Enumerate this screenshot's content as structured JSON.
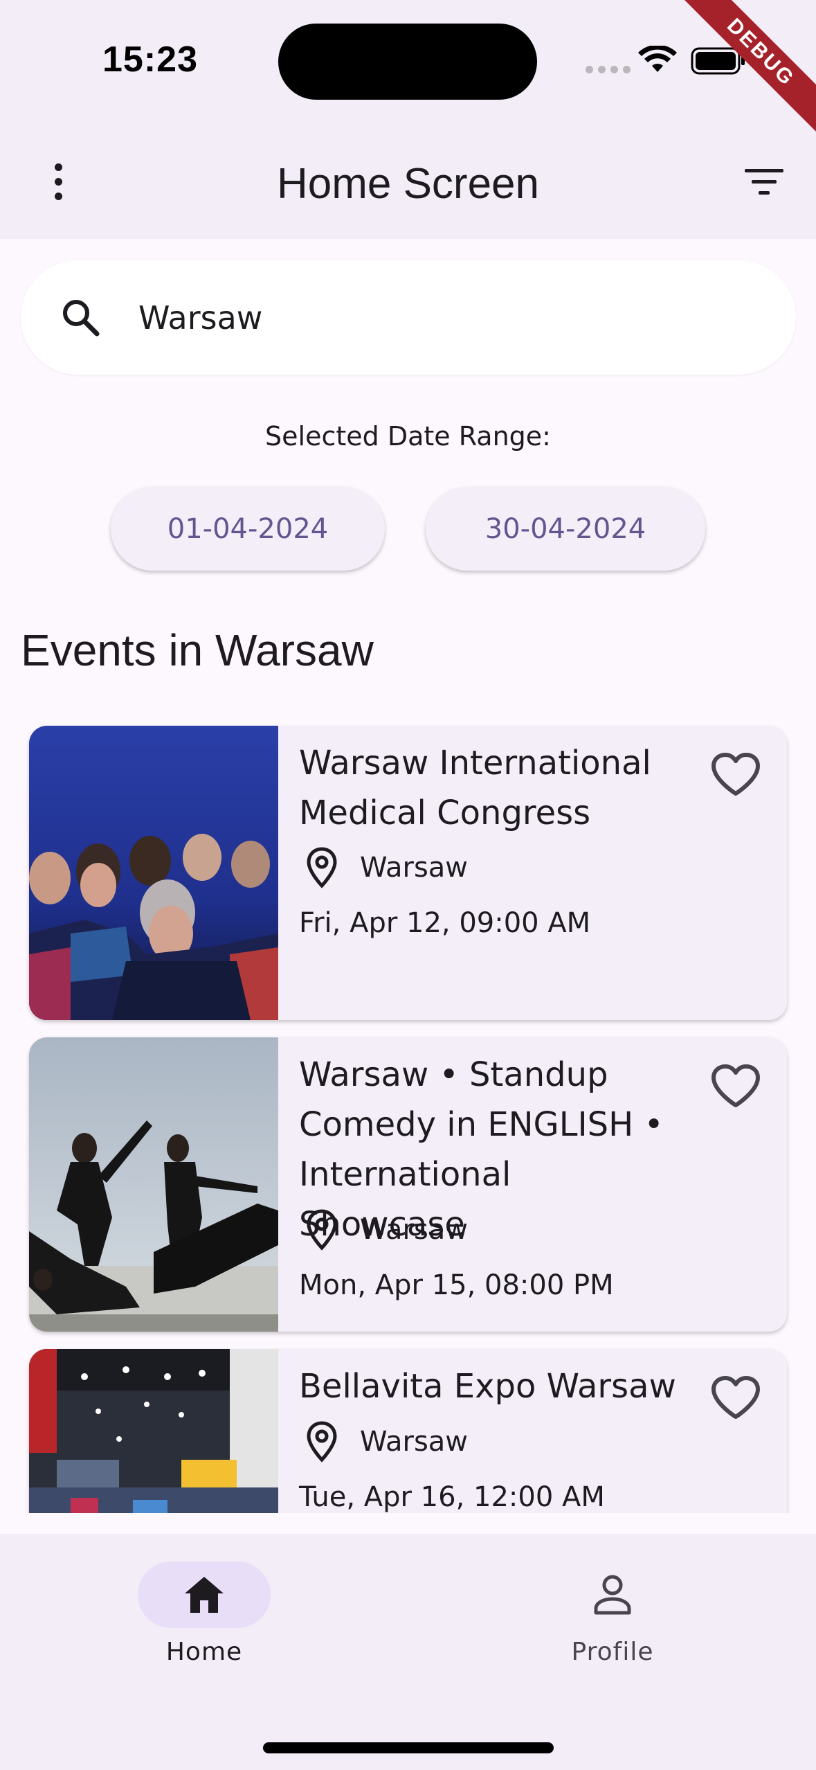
{
  "status_bar": {
    "time": "15:23",
    "debug_banner": "DEBUG",
    "wifi_icon": "wifi-icon",
    "battery_icon": "battery-icon"
  },
  "app_bar": {
    "title": "Home Screen",
    "menu_icon": "more-vert-icon",
    "filter_icon": "filter-icon"
  },
  "search": {
    "value": "Warsaw",
    "icon": "search-icon"
  },
  "date_range": {
    "label": "Selected Date Range:",
    "start": "01-04-2024",
    "end": "30-04-2024"
  },
  "section_title": "Events in Warsaw",
  "events": [
    {
      "title": "Warsaw International Medical Congress",
      "location": "Warsaw",
      "date": "Fri, Apr 12, 09:00 AM",
      "image": "conference-audience-photo",
      "favorite": false
    },
    {
      "title": "Warsaw • Standup Comedy in ENGLISH • International Showcase",
      "location": "Warsaw",
      "date": "Mon, Apr 15, 08:00 PM",
      "image": "dancers-performance-photo",
      "favorite": false
    },
    {
      "title": "Bellavita Expo Warsaw",
      "location": "Warsaw",
      "date": "Tue, Apr 16, 12:00 AM",
      "image": "expo-hall-photo",
      "favorite": false
    }
  ],
  "bottom_nav": {
    "items": [
      {
        "label": "Home",
        "icon": "home-icon",
        "selected": true
      },
      {
        "label": "Profile",
        "icon": "person-icon",
        "selected": false
      }
    ]
  },
  "colors": {
    "background": "#fdf7fe",
    "surface": "#f3edf7",
    "card": "#f4eef8",
    "accent": "#65558f",
    "nav_indicator": "#e8def8"
  }
}
